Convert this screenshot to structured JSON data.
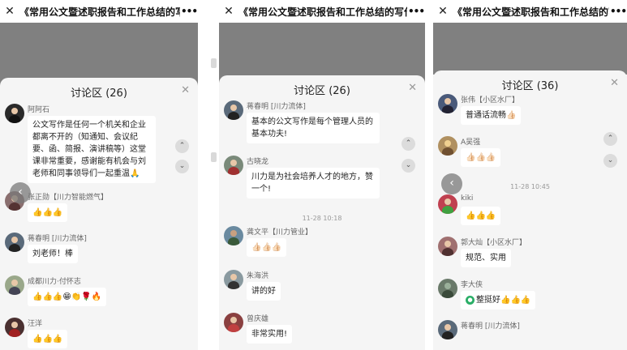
{
  "title": "《常用公文暨述职报告和工作总结的写作》",
  "more_icon": "more-dots-icon",
  "close_icon": "close-icon",
  "screens": [
    {
      "discussion_header": "讨论区 (26)",
      "messages": [
        {
          "name": "阿阿石",
          "text": "公文写作是任何一个机关和企业都离不开的（知通知、会议纪要、函、简报、演讲稿等）这堂课非常重要，感谢能有机会与刘老师和同事领导们一起重温🙏"
        },
        {
          "name": "张正勋【川力智能燃气】",
          "text": "👍👍👍"
        },
        {
          "name": "蒋春明 [川力流体]",
          "text": "刘老师！棒"
        },
        {
          "name": "成都川力·付怀志",
          "text": "👍👍👍😁👏🌹🔥"
        },
        {
          "name": "汪洋",
          "text": "👍👍👍"
        }
      ]
    },
    {
      "discussion_header": "讨论区 (26)",
      "messages": [
        {
          "name": "蒋春明 [川力流体]",
          "text": "基本的公文写作是每个管理人员的基本功夫!"
        },
        {
          "name": "古晓龙",
          "text": "川力是为社会培养人才的地方，赞一个!"
        },
        {
          "name": "龚文平【川力管业】",
          "text": "👍🏻👍🏻👍🏻"
        },
        {
          "name": "朱海洪",
          "text": "讲的好"
        },
        {
          "name": "曾庆雄",
          "text": "非常实用!"
        }
      ],
      "timestamp": "11-28 10:18"
    },
    {
      "discussion_header": "讨论区 (36)",
      "messages": [
        {
          "name": "张伟【小区水厂】",
          "text": "普通话流畅👍🏻"
        },
        {
          "name": "A吴强",
          "text": "👍🏻👍🏻👍🏻"
        },
        {
          "name": "kiki",
          "text": "👍👍👍"
        },
        {
          "name": "郭大灿【小区水厂】",
          "text": "规范、实用"
        },
        {
          "name": "李大侠",
          "text": "整挺好👍👍👍",
          "badge": "wechat-icon"
        },
        {
          "name": "蒋春明 [川力流体]",
          "text": ""
        }
      ],
      "timestamp": "11-28 10:45"
    }
  ]
}
